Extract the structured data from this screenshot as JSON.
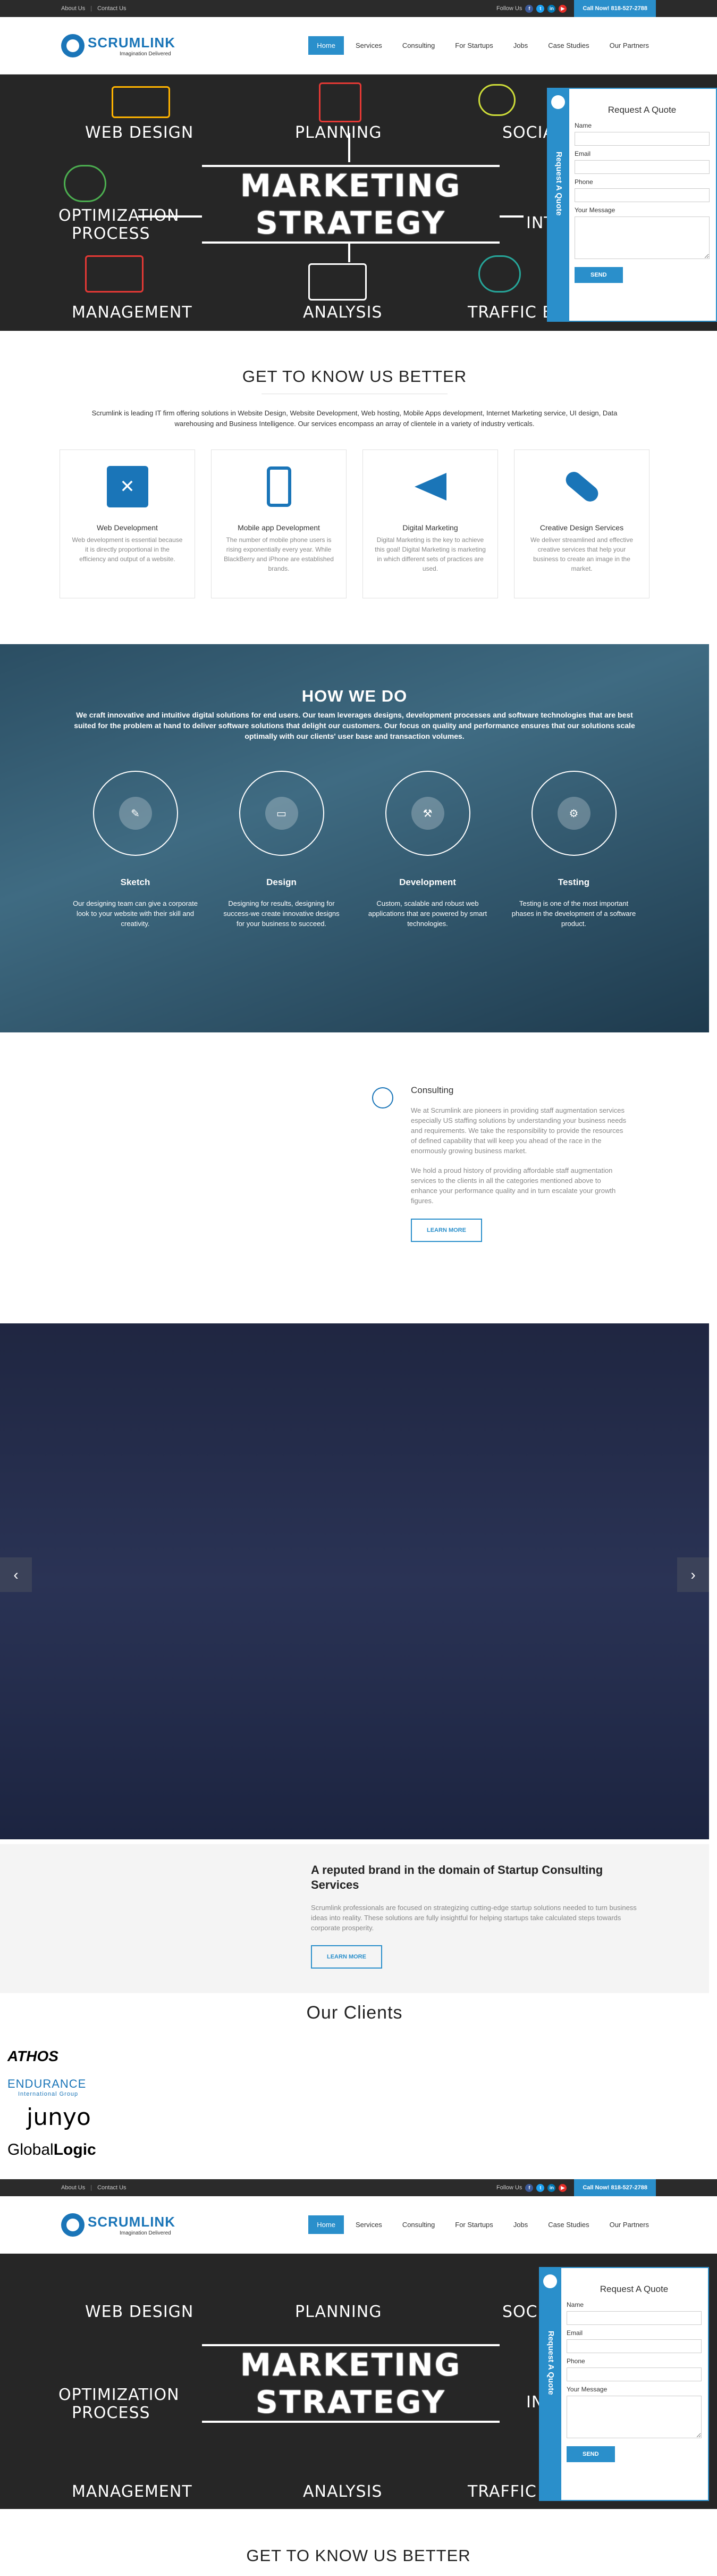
{
  "topbar": {
    "about": "About Us",
    "contact": "Contact Us",
    "follow": "Follow Us",
    "call": "Call Now! 818-527-2788"
  },
  "header": {
    "logo_name": "SCRUMLINK",
    "logo_tagline": "Imagination Delivered"
  },
  "nav": [
    "Home",
    "Services",
    "Consulting",
    "For Startups",
    "Jobs",
    "Case Studies",
    "Our Partners"
  ],
  "hero": {
    "labels": {
      "web_design": "WEB DESIGN",
      "planning": "PLANNING",
      "social": "SOCIAL",
      "optimization": "OPTIMIZATION",
      "process": "PROCESS",
      "int": "INT",
      "management": "MANAGEMENT",
      "analysis": "ANALYSIS",
      "traffic": "TRAFFIC BUILDING"
    },
    "marketing": "MARKETING",
    "strategy": "STRATEGY"
  },
  "quote": {
    "tab": "Request A Quote",
    "title": "Request A Quote",
    "name": "Name",
    "email": "Email",
    "phone": "Phone",
    "message": "Your Message",
    "send": "SEND"
  },
  "know": {
    "title": "GET TO KNOW US BETTER",
    "intro": "Scrumlink is leading IT firm offering solutions in Website Design, Website Development, Web hosting, Mobile Apps development, Internet Marketing service, UI design, Data warehousing and Business Intelligence. Our services encompass an array of clientele in a variety of industry verticals.",
    "cards": [
      {
        "title": "Web Development",
        "text": "Web development is essential because it is directly proportional in the efficiency and output of a website."
      },
      {
        "title": "Mobile app Development",
        "text": "The number of mobile phone users is rising exponentially every year. While BlackBerry and iPhone are established brands."
      },
      {
        "title": "Digital Marketing",
        "text": "Digital Marketing is the key to achieve this goal! Digital Marketing is marketing in which different sets of practices are used."
      },
      {
        "title": "Creative Design Services",
        "text": "We deliver streamlined and effective creative services that help your business to create an image in the market."
      }
    ]
  },
  "how": {
    "title": "HOW WE DO",
    "desc": "We craft innovative and intuitive digital solutions for end users. Our team leverages designs, development processes and software technologies that are best suited for the problem at hand to deliver software solutions that delight our customers. Our focus on quality and performance ensures that our solutions scale optimally with our clients' user base and transaction volumes.",
    "steps": [
      {
        "title": "Sketch",
        "text": "Our designing team can give a corporate look to your website with their skill and creativity."
      },
      {
        "title": "Design",
        "text": "Designing for results, designing for success-we create innovative designs for your business to succeed."
      },
      {
        "title": "Development",
        "text": "Custom, scalable and robust web applications that are powered by smart technologies."
      },
      {
        "title": "Testing",
        "text": "Testing is one of the most important phases in the development of a software product."
      }
    ]
  },
  "consulting": {
    "title": "Consulting",
    "p1": "We at Scrumlink are pioneers in providing staff augmentation services especially US staffing solutions by understanding your business needs and requirements. We take the responsibility to provide the resources of defined capability that will keep you ahead of the race in the enormously growing business market.",
    "p2": "We hold a proud history of providing affordable staff augmentation services to the clients in all the categories mentioned above to enhance your performance quality and in turn escalate your growth figures.",
    "button": "LEARN MORE"
  },
  "slider": {
    "prev": "‹",
    "next": "›"
  },
  "startup": {
    "title": "A reputed brand in the domain of Startup Consulting Services",
    "text": "Scrumlink professionals are focused on strategizing cutting-edge startup solutions needed to turn business ideas into reality. These solutions are fully insightful for helping startups take calculated steps towards corporate prosperity.",
    "button": "LEARN MORE"
  },
  "clients": {
    "title": "Our Clients",
    "logos": [
      "ATHOS",
      "ENDURANCE",
      "International Group",
      "junyo",
      "Global",
      "Logic"
    ]
  },
  "colors": {
    "accent": "#2a8fcb",
    "dark": "#2b2b2b"
  }
}
